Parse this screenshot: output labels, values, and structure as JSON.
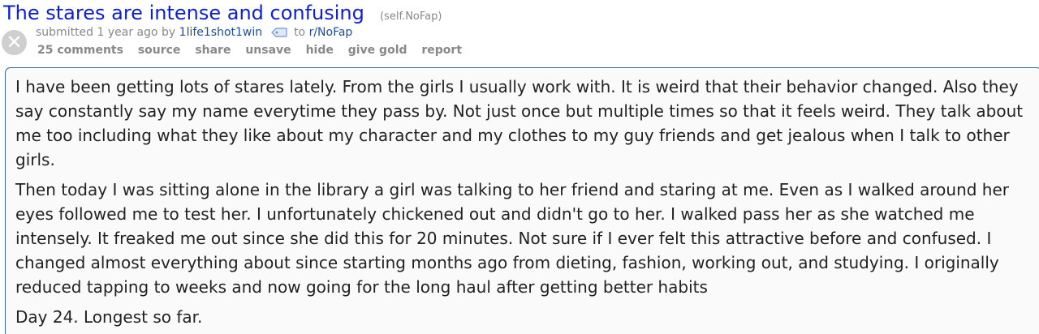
{
  "post": {
    "title": "The stares are intense and confusing",
    "domain": "(self.NoFap)",
    "tagline": {
      "submitted": "submitted 1 year ago by",
      "author": "1life1shot1win",
      "to": "to",
      "subreddit": "r/NoFap"
    },
    "buttons": {
      "comments": "25 comments",
      "source": "source",
      "share": "share",
      "unsave": "unsave",
      "hide": "hide",
      "give_gold": "give gold",
      "report": "report"
    },
    "body": {
      "p1": "I have been getting lots of stares lately. From the girls I usually work with. It is weird that their behavior changed. Also they say constantly say my name everytime they pass by. Not just once but multiple times so that it feels weird. They talk about me too including what they like about my character and my clothes to my guy friends and get jealous when I talk to other girls.",
      "p2": "Then today I was sitting alone in the library a girl was talking to her friend and staring at me. Even as I walked around her eyes followed me to test her. I unfortunately chickened out and didn't go to her. I walked pass her as she watched me intensely. It freaked me out since she did this for 20 minutes. Not sure if I ever felt this attractive before and confused. I changed almost everything about since starting months ago from dieting, fashion, working out, and studying. I originally reduced tapping to weeks and now going for the long haul after getting better habits",
      "p3": "Day 24. Longest so far."
    }
  },
  "icons": {
    "thumbnail": "close-icon",
    "author_tag": "tag-icon"
  },
  "colors": {
    "title": "#0d1fd6",
    "link": "#1a4e9c",
    "muted": "#888888",
    "border": "#336699"
  }
}
